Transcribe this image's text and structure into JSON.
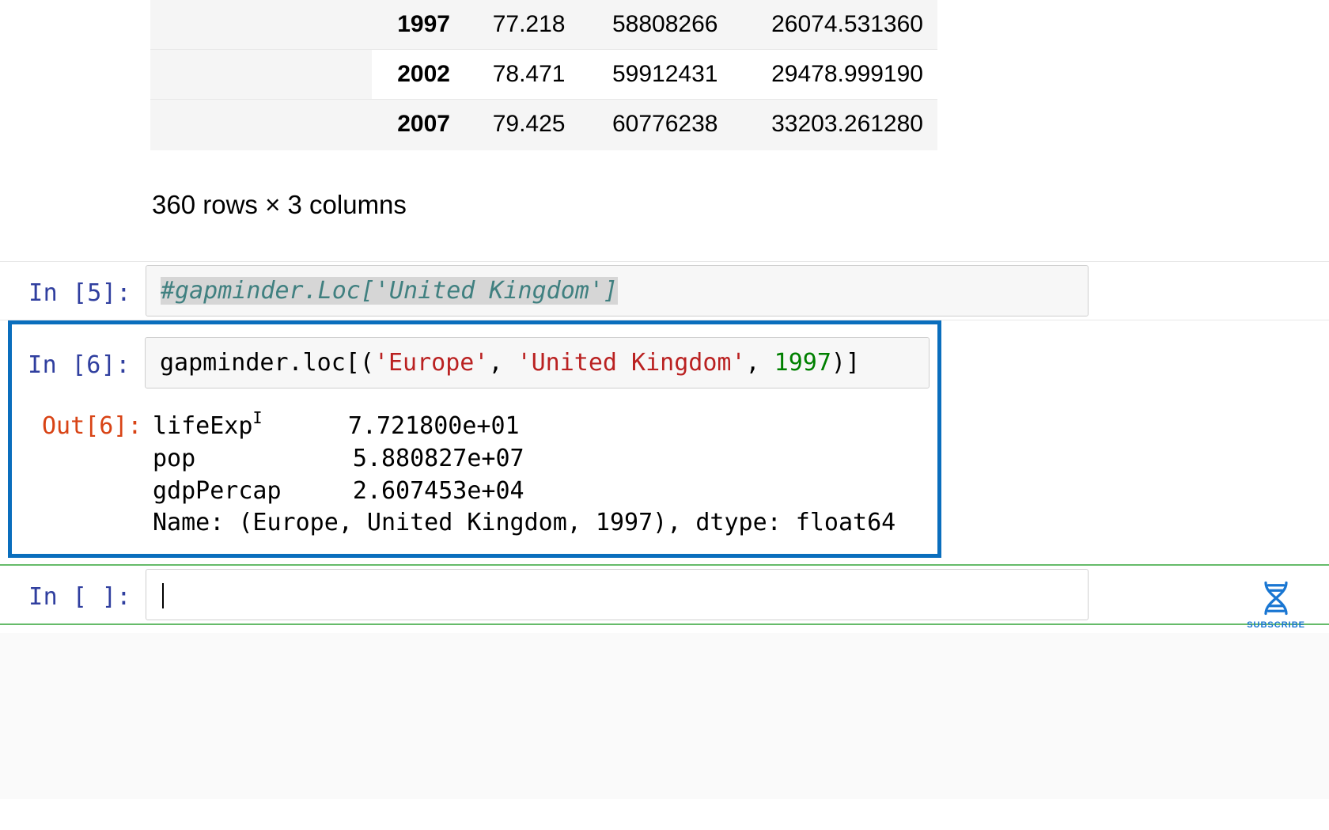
{
  "table": {
    "rows": [
      {
        "year": "1997",
        "lifeExp": "77.218",
        "pop": "58808266",
        "gdp": "26074.531360"
      },
      {
        "year": "2002",
        "lifeExp": "78.471",
        "pop": "59912431",
        "gdp": "29478.999190"
      },
      {
        "year": "2007",
        "lifeExp": "79.425",
        "pop": "60776238",
        "gdp": "33203.261280"
      }
    ],
    "shape_text": "360 rows × 3 columns"
  },
  "cell5": {
    "prompt": "In [5]:",
    "code_comment": "#gapminder.Loc['United Kingdom']"
  },
  "cell6": {
    "in_prompt": "In [6]:",
    "out_prompt": "Out[6]:",
    "code": {
      "p1": "gapminder.loc[(",
      "s1": "'Europe'",
      "c1": ", ",
      "s2": "'United Kingdom'",
      "c2": ", ",
      "n1": "1997",
      "p2": ")]"
    },
    "output_lines": {
      "l1a": "lifeExp",
      "l1sup": "I",
      "l1b": "      7.721800e+01",
      "l2": "pop           5.880827e+07",
      "l3": "gdpPercap     2.607453e+04",
      "l4": "Name: (Europe, United Kingdom, 1997), dtype: float64"
    }
  },
  "cell_empty": {
    "prompt": "In [ ]:"
  },
  "subscribe": "SUBSCRIBE"
}
